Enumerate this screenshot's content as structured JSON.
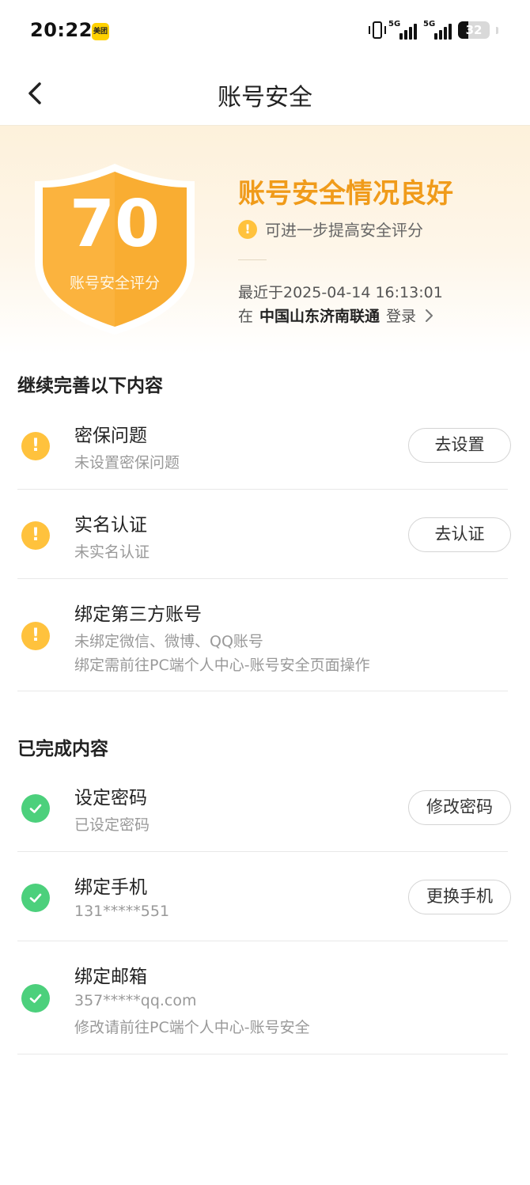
{
  "status_bar": {
    "time": "20:22",
    "app_badge": "美团",
    "signal1_label": "5G",
    "signal2_label": "5G",
    "battery": "32",
    "battery_level": 0.32
  },
  "nav": {
    "title": "账号安全"
  },
  "hero": {
    "score": "70",
    "score_label": "账号安全评分",
    "status_text": "账号安全情况良好",
    "hint": "可进一步提高安全评分",
    "last_login": "最近于2025-04-14 16:13:01",
    "location_prefix": "在",
    "carrier": "中国山东济南联通",
    "location_suffix": "登录"
  },
  "pending": {
    "title": "继续完善以下内容",
    "items": [
      {
        "title": "密保问题",
        "sub": "未设置密保问题",
        "button": "去设置"
      },
      {
        "title": "实名认证",
        "sub": "未实名认证",
        "button": "去认证"
      },
      {
        "title": "绑定第三方账号",
        "sub": "未绑定微信、微博、QQ账号",
        "sub2": "绑定需前往PC端个人中心-账号安全页面操作"
      }
    ]
  },
  "done": {
    "title": "已完成内容",
    "items": [
      {
        "title": "设定密码",
        "sub": "已设定密码",
        "button": "修改密码"
      },
      {
        "title": "绑定手机",
        "sub": "131*****551",
        "button": "更换手机"
      },
      {
        "title": "绑定邮箱",
        "sub": "357*****qq.com",
        "sub2": "修改请前往PC端个人中心-账号安全"
      }
    ]
  },
  "colors": {
    "accent": "#f09b1a",
    "warning": "#ffc23d",
    "success": "#4cd07c",
    "shield": "#fbb33e"
  },
  "icons": {
    "back": "chevron-left-icon",
    "warning": "exclamation-circle-icon",
    "success": "check-circle-icon",
    "shield": "shield-icon"
  }
}
